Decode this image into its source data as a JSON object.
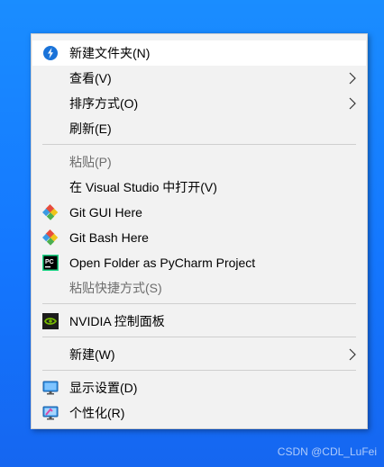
{
  "context_menu": {
    "items": [
      {
        "label": "新建文件夹(N)",
        "icon": "new-folder-icon",
        "submenu": false,
        "disabled": false,
        "highlighted": true
      },
      {
        "label": "查看(V)",
        "icon": "",
        "submenu": true,
        "disabled": false
      },
      {
        "label": "排序方式(O)",
        "icon": "",
        "submenu": true,
        "disabled": false
      },
      {
        "label": "刷新(E)",
        "icon": "",
        "submenu": false,
        "disabled": false
      },
      {
        "label": "粘贴(P)",
        "icon": "",
        "submenu": false,
        "disabled": true
      },
      {
        "label": "在 Visual Studio 中打开(V)",
        "icon": "",
        "submenu": false,
        "disabled": false
      },
      {
        "label": "Git GUI Here",
        "icon": "git-gui-icon",
        "submenu": false,
        "disabled": false
      },
      {
        "label": "Git Bash Here",
        "icon": "git-bash-icon",
        "submenu": false,
        "disabled": false
      },
      {
        "label": "Open Folder as PyCharm Project",
        "icon": "pycharm-icon",
        "submenu": false,
        "disabled": false
      },
      {
        "label": "粘贴快捷方式(S)",
        "icon": "",
        "submenu": false,
        "disabled": true
      },
      {
        "label": "NVIDIA 控制面板",
        "icon": "nvidia-icon",
        "submenu": false,
        "disabled": false
      },
      {
        "label": "新建(W)",
        "icon": "",
        "submenu": true,
        "disabled": false
      },
      {
        "label": "显示设置(D)",
        "icon": "display-settings-icon",
        "submenu": false,
        "disabled": false
      },
      {
        "label": "个性化(R)",
        "icon": "personalize-icon",
        "submenu": false,
        "disabled": false
      }
    ]
  },
  "watermark": "CSDN @CDL_LuFei",
  "colors": {
    "desktop": "#1477ff",
    "menu_bg": "#f2f2f2",
    "hover_bg": "#ffffff",
    "disabled_text": "#6d6d6d"
  }
}
